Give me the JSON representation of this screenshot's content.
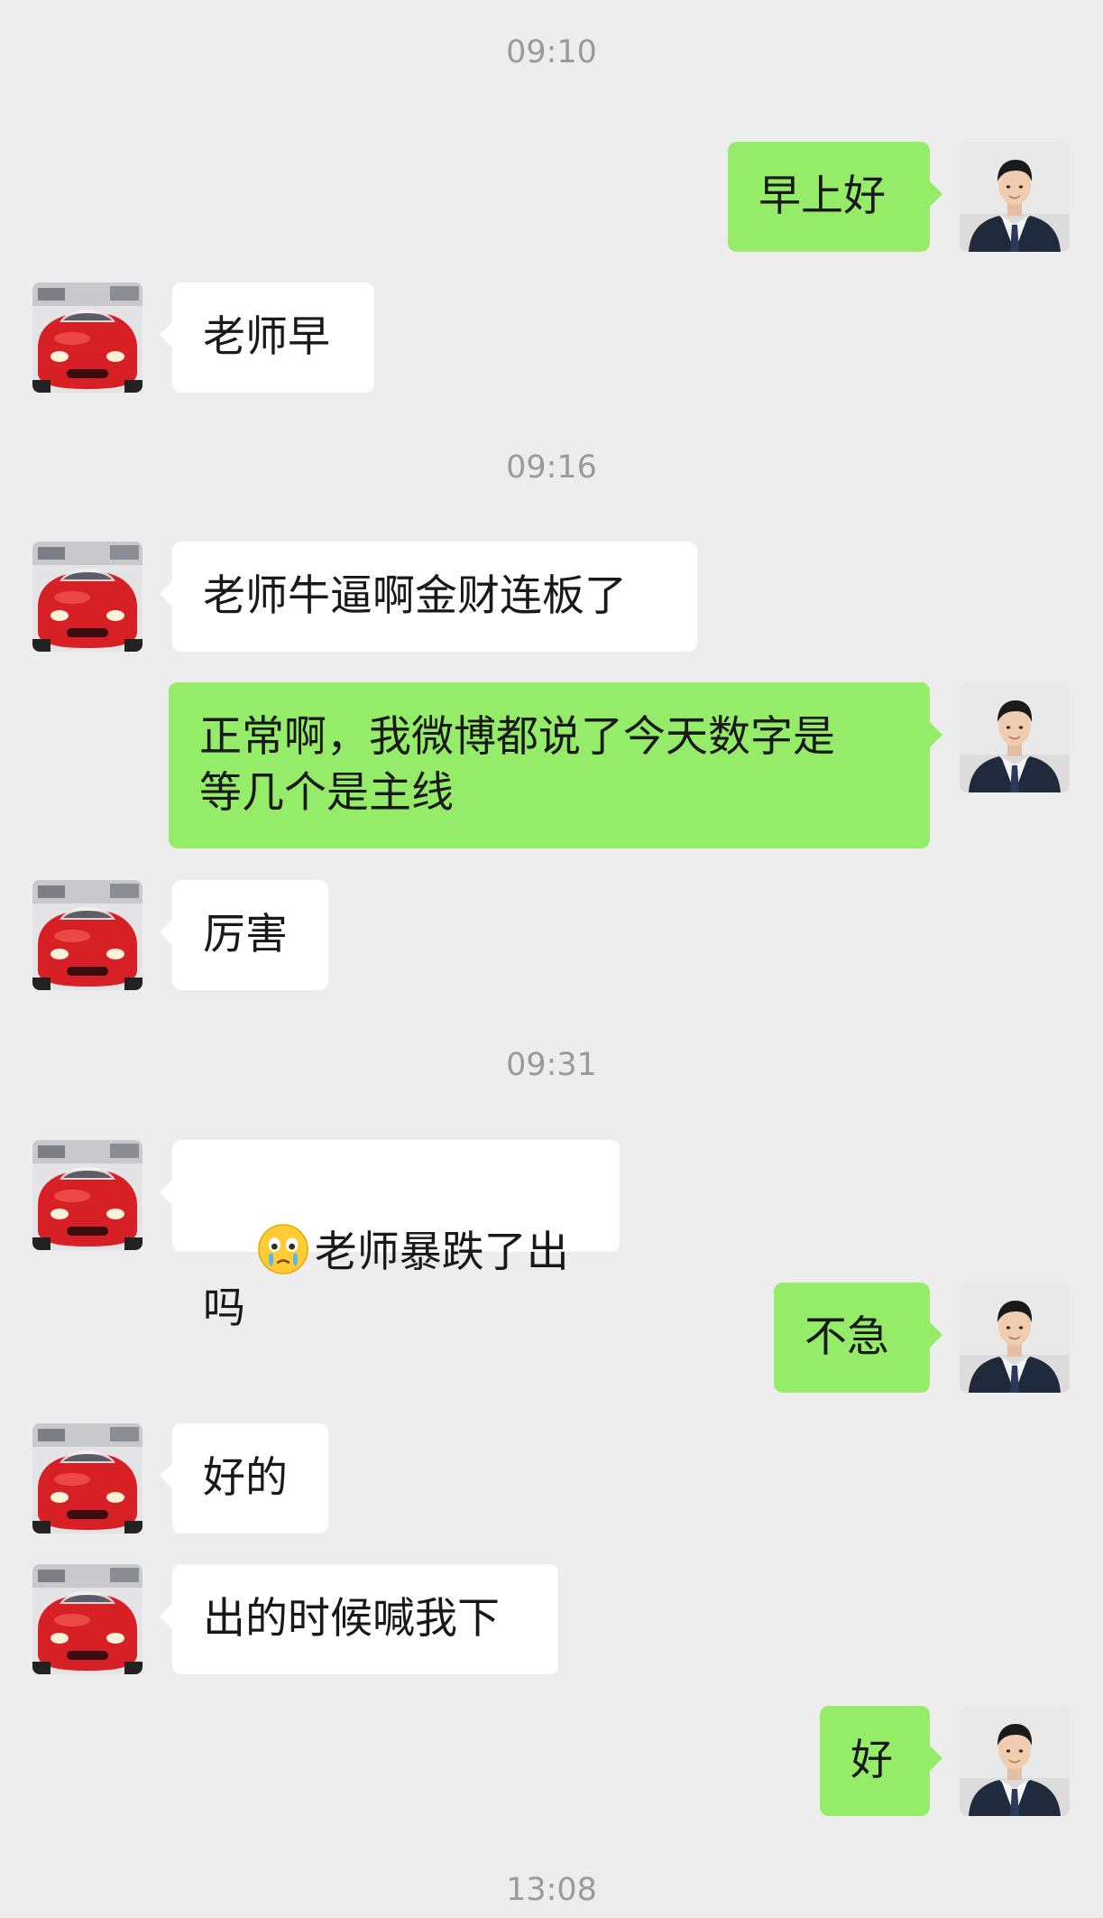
{
  "messages": [
    {
      "type": "time",
      "text": "09:10"
    },
    {
      "type": "sent",
      "text": "早上好"
    },
    {
      "type": "received",
      "text": "老师早"
    },
    {
      "type": "time",
      "text": "09:16"
    },
    {
      "type": "received",
      "text": "老师牛逼啊金财连板了"
    },
    {
      "type": "sent",
      "text": "正常啊，我微博都说了今天数字是\n等几个是主线"
    },
    {
      "type": "received",
      "text": "厉害"
    },
    {
      "type": "time",
      "text": "09:31"
    },
    {
      "type": "received",
      "emoji": "crying-face-emoji",
      "text": "老师暴跌了出吗"
    },
    {
      "type": "sent",
      "text": "不急"
    },
    {
      "type": "received",
      "text": "好的"
    },
    {
      "type": "received",
      "text": "出的时候喊我下"
    },
    {
      "type": "sent",
      "text": "好"
    },
    {
      "type": "time",
      "text": "13:08"
    }
  ],
  "avatars": {
    "self": "man-in-suit-avatar",
    "contact": "red-sports-car-avatar"
  },
  "colors": {
    "background": "#ededed",
    "sent_bubble": "#95ec69",
    "received_bubble": "#ffffff",
    "timestamp_text": "#9a9a9a",
    "message_text": "#191919"
  }
}
